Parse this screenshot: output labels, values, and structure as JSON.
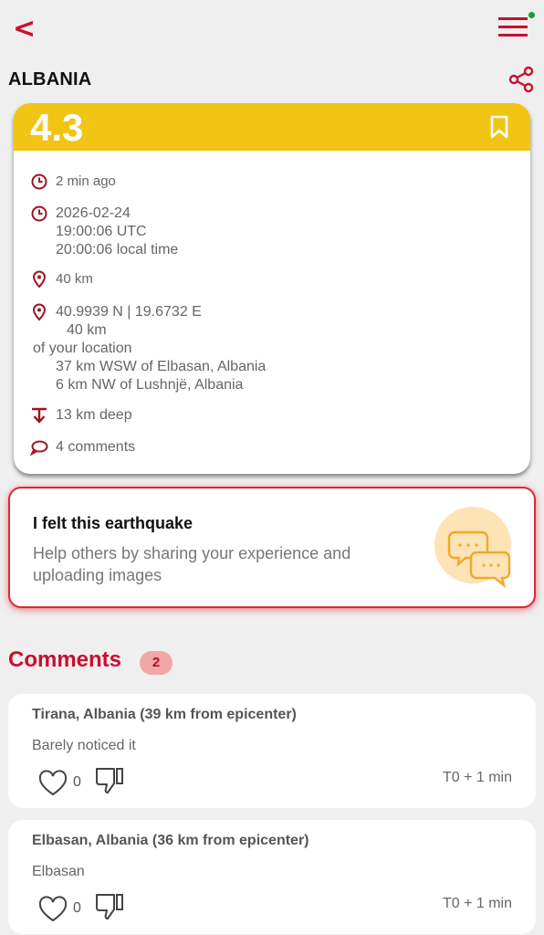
{
  "header": {
    "back_label": "<",
    "region": "ALBANIA"
  },
  "quake": {
    "magnitude": "4.3",
    "time_ago": "2 min ago",
    "date": "2026-02-24",
    "utc_time": "19:00:06 UTC",
    "local_time": "20:00:06 local time",
    "distance": "40 km",
    "coords": "40.9939 N | 19.6732 E",
    "coords_distance": "40 km",
    "of_location": "of your location",
    "place_1": "37 km WSW of Elbasan, Albania",
    "place_2": "6 km NW of Lushnjë, Albania",
    "depth": "13 km deep",
    "comments_count_label": "4  comments"
  },
  "felt_card": {
    "title": "I felt this earthquake",
    "description": "Help others by sharing your experience and uploading images"
  },
  "comments_section": {
    "title": "Comments",
    "badge": "2",
    "items": [
      {
        "location": "Tirana, Albania (39 km from epicenter)",
        "text": "Barely noticed it",
        "likes": "0",
        "time": "T0 + 1 min"
      },
      {
        "location": "Elbasan, Albania (36 km from epicenter)",
        "text": "Elbasan",
        "likes": "0",
        "time": "T0 + 1 min"
      }
    ]
  },
  "colors": {
    "accent": "#c8102e",
    "magnitude_bar": "#f2c414",
    "status_dot": "#1a9c3e"
  }
}
